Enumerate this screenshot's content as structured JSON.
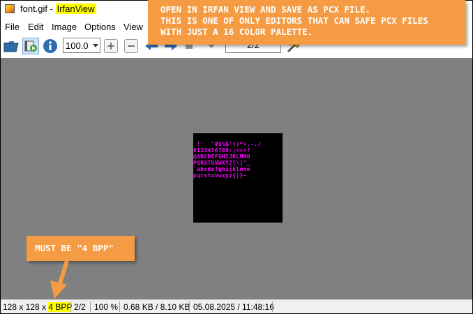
{
  "window": {
    "file_name": "font.gif - ",
    "app_name": "IrfanView"
  },
  "menu": {
    "items": [
      "File",
      "Edit",
      "Image",
      "Options",
      "View"
    ]
  },
  "toolbar": {
    "zoom_value": "100.0",
    "page_value": "2/2",
    "icons": [
      "open-folder-icon",
      "slideshow-icon",
      "info-icon",
      "zoom-in-icon",
      "zoom-out-icon",
      "prev-arrow-icon",
      "next-arrow-icon",
      "tools-icon"
    ]
  },
  "image": {
    "rows": [
      " !   \"#$%&'()*+,-./",
      "0123456789:;<=>?",
      "@ABCDEFGHIJKLMNO",
      "PQRSTUVWXYZ[\\]^_",
      "`abcdefghijklmno",
      "pqrstuvwxyz{|}~"
    ],
    "glyph_color": "#ff00ff",
    "background_color": "#000000"
  },
  "statusbar": {
    "dimensions": "128 x 128 x ",
    "bpp": "4 BPP",
    "page": "2/2",
    "zoom": "100 %",
    "size": "0.68 KB / 8.10 KB",
    "datetime": "05.08.2025 / 11:48:16"
  },
  "annotations": {
    "top_lines": [
      "Open in Irfan View and save as PCX file.",
      "This is one of only editors that can safe PCX files",
      "with just a 16 color palette."
    ],
    "bpp_note": "MUST BE \"4 BPP\"",
    "accent_color": "#f49b43",
    "highlight_color": "#ffff00"
  }
}
